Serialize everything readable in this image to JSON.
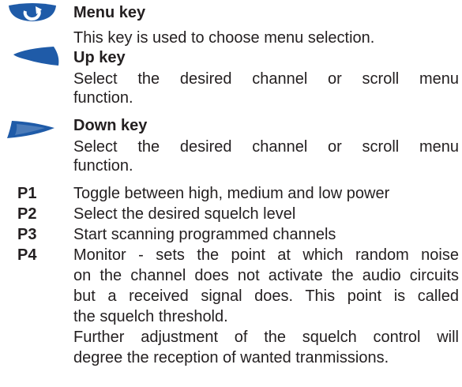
{
  "keys": [
    {
      "icon": "menu-key-icon",
      "title": "Menu key",
      "lines": [
        "This key is used to choose menu selection."
      ]
    },
    {
      "icon": "up-key-icon",
      "title": "Up key",
      "lines": [
        "Select the desired channel or scroll menu",
        "function."
      ]
    },
    {
      "icon": "down-key-icon",
      "title": "Down key",
      "lines": [
        "Select the desired channel or scroll menu",
        "function."
      ]
    }
  ],
  "programmable": [
    {
      "label": "P1",
      "lines": [
        "Toggle between high, medium and low power"
      ]
    },
    {
      "label": "P2",
      "lines": [
        "Select the desired squelch level"
      ]
    },
    {
      "label": "P3",
      "lines": [
        "Start scanning programmed channels"
      ]
    },
    {
      "label": "P4",
      "lines": [
        "Monitor - sets the point at which random noise",
        "on the channel does not activate the audio circuits",
        "but a received signal does. This point is called",
        "the squelch threshold.",
        "Further adjustment of the squelch control will",
        "degree the reception of wanted tranmissions."
      ]
    }
  ],
  "colors": {
    "icon_fill": "#1f5ba8",
    "text": "#231f20"
  }
}
